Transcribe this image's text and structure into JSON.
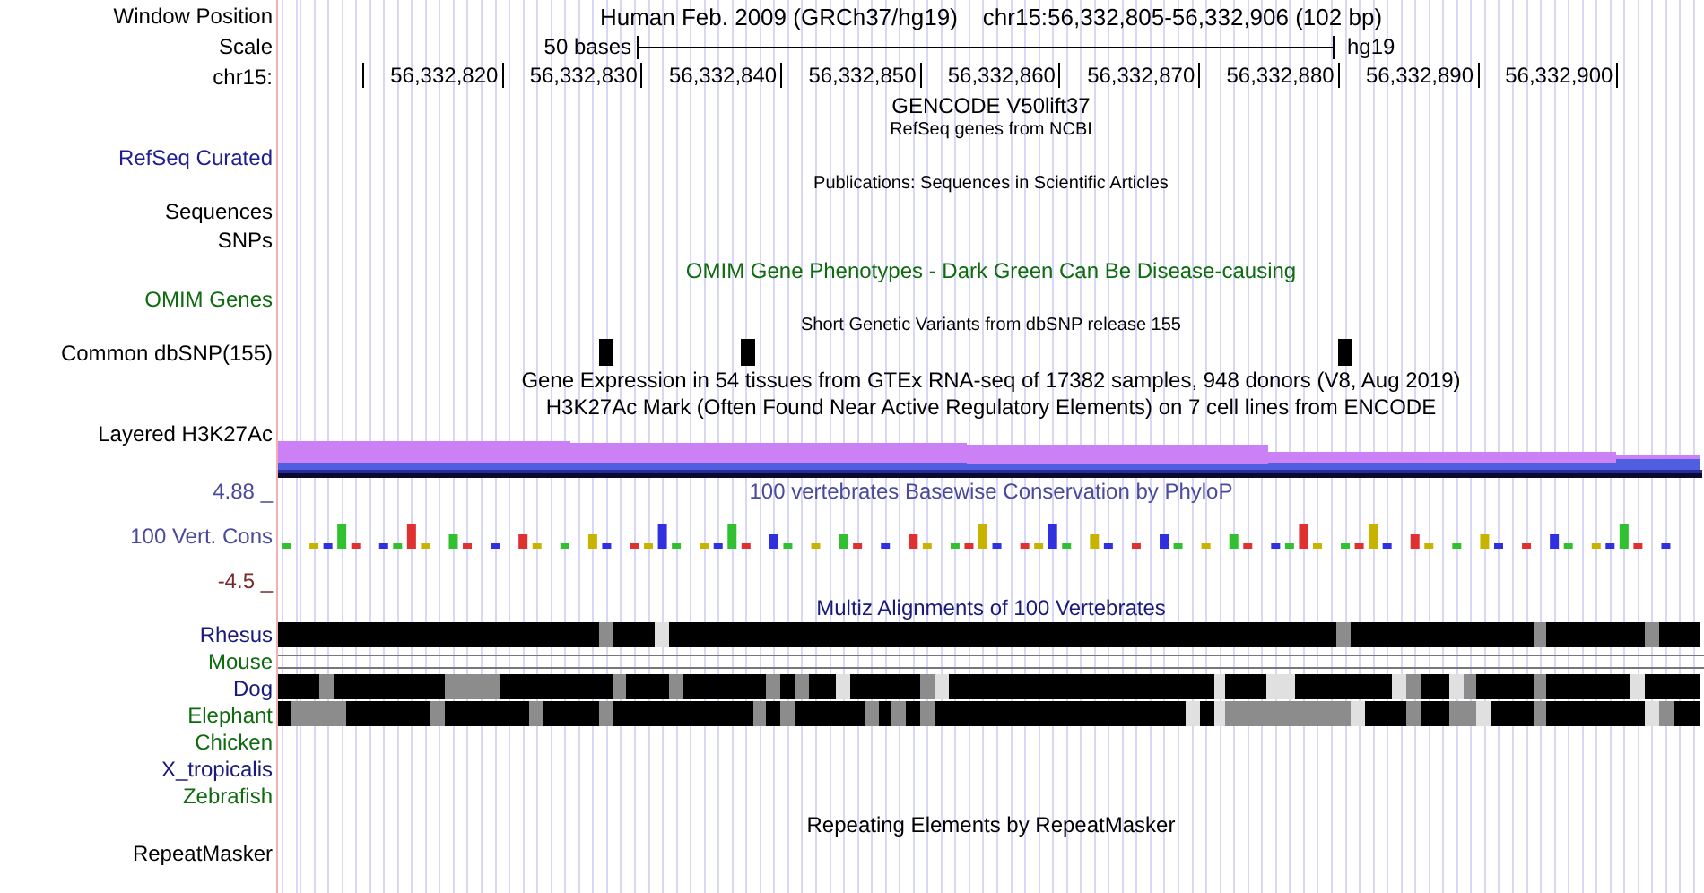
{
  "header": {
    "label": "Window Position",
    "assembly": "Human Feb. 2009 (GRCh37/hg19)",
    "position": "chr15:56,332,805-56,332,906 (102 bp)"
  },
  "scale": {
    "label": "Scale",
    "bar_label": "50 bases",
    "assembly": "hg19"
  },
  "ruler": {
    "label": "chr15:",
    "ticks": [
      "56,332,820",
      "56,332,830",
      "56,332,840",
      "56,332,850",
      "56,332,860",
      "56,332,870",
      "56,332,880",
      "56,332,890",
      "56,332,900"
    ]
  },
  "tracks": [
    {
      "kind": "title",
      "title": "GENCODE V50lift37",
      "color": "#000000"
    },
    {
      "kind": "note",
      "title": "RefSeq genes from NCBI",
      "color": "#000000"
    },
    {
      "kind": "blank",
      "label": {
        "text": "RefSeq Curated",
        "color": "#1f1f8f"
      }
    },
    {
      "kind": "note",
      "title": "Publications: Sequences in Scientific Articles",
      "color": "#000000"
    },
    {
      "kind": "blank",
      "label": {
        "text": "Sequences",
        "color": "#000000"
      }
    },
    {
      "kind": "blank",
      "label": {
        "text": "SNPs",
        "color": "#000000"
      }
    },
    {
      "kind": "title",
      "title": "OMIM Gene Phenotypes - Dark Green Can Be Disease-causing",
      "color": "#0e6b0e"
    },
    {
      "kind": "blank",
      "label": {
        "text": "OMIM Genes",
        "color": "#0e6b0e"
      }
    },
    {
      "kind": "note",
      "title": "Short Genetic Variants from dbSNP release 155",
      "color": "#000000"
    },
    {
      "kind": "snp",
      "label": {
        "text": "Common dbSNP(155)",
        "color": "#000000"
      }
    },
    {
      "kind": "title",
      "title": "Gene Expression in 54 tissues from GTEx RNA-seq of 17382 samples, 948 donors (V8, Aug 2019)",
      "color": "#000000"
    },
    {
      "kind": "title",
      "title": "H3K27Ac Mark (Often Found Near Active Regulatory Elements) on 7 cell lines from ENCODE",
      "color": "#000000"
    },
    {
      "kind": "layered",
      "label": {
        "text": "Layered H3K27Ac",
        "color": "#000000"
      }
    },
    {
      "kind": "title",
      "title": "100 vertebrates Basewise Conservation by PhyloP",
      "color": "#4a4a9a",
      "label": {
        "text": "4.88 _",
        "color": "#4a4a9a"
      }
    },
    {
      "kind": "conservation",
      "label": {
        "text": "100 Vert. Cons",
        "color": "#4a4a9a"
      }
    },
    {
      "kind": "blank",
      "label": {
        "text": "-4.5 _",
        "color": "#7a2a2a"
      }
    },
    {
      "kind": "title",
      "title": "Multiz Alignments of 100 Vertebrates",
      "color": "#1a1a7a"
    },
    {
      "kind": "alignment",
      "label": {
        "text": "Rhesus",
        "color": "#1a1a7a"
      }
    },
    {
      "kind": "lines",
      "label": {
        "text": "Mouse",
        "color": "#0e6b0e"
      }
    },
    {
      "kind": "alignment",
      "label": {
        "text": "Dog",
        "color": "#1a1a7a"
      }
    },
    {
      "kind": "alignment",
      "label": {
        "text": "Elephant",
        "color": "#0e6b0e"
      }
    },
    {
      "kind": "blank",
      "label": {
        "text": "Chicken",
        "color": "#0e6b0e"
      }
    },
    {
      "kind": "blank",
      "label": {
        "text": "X_tropicalis",
        "color": "#1a1a7a"
      }
    },
    {
      "kind": "blank",
      "label": {
        "text": "Zebrafish",
        "color": "#0e6b0e"
      }
    },
    {
      "kind": "title",
      "title": "Repeating Elements by RepeatMasker",
      "color": "#000000"
    },
    {
      "kind": "blank",
      "label": {
        "text": "RepeatMasker",
        "color": "#000000"
      }
    }
  ]
}
